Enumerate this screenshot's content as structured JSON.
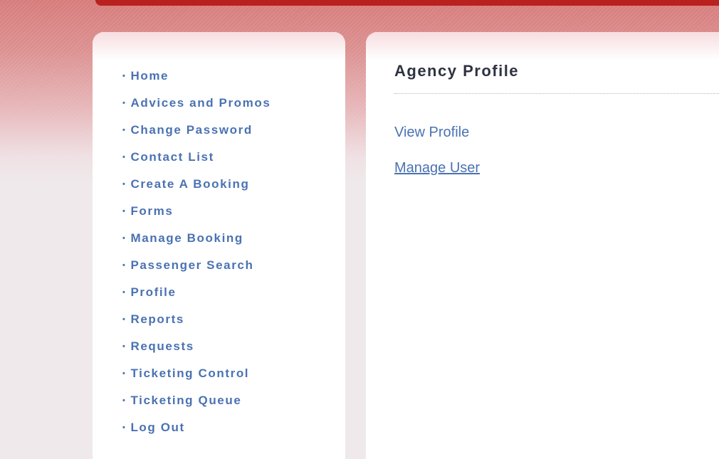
{
  "sidebar": {
    "items": [
      {
        "label": "Home"
      },
      {
        "label": "Advices and Promos"
      },
      {
        "label": "Change Password"
      },
      {
        "label": "Contact List"
      },
      {
        "label": "Create A Booking"
      },
      {
        "label": "Forms"
      },
      {
        "label": "Manage Booking"
      },
      {
        "label": "Passenger Search"
      },
      {
        "label": "Profile"
      },
      {
        "label": "Reports"
      },
      {
        "label": "Requests"
      },
      {
        "label": "Ticketing Control"
      },
      {
        "label": "Ticketing Queue"
      },
      {
        "label": "Log Out"
      }
    ]
  },
  "main": {
    "title": "Agency Profile",
    "links": [
      {
        "label": "View Profile"
      },
      {
        "label": "Manage User"
      }
    ]
  },
  "colors": {
    "accent_red": "#b8211e",
    "link_blue": "#4a72b2",
    "title_text": "#2f3340"
  }
}
